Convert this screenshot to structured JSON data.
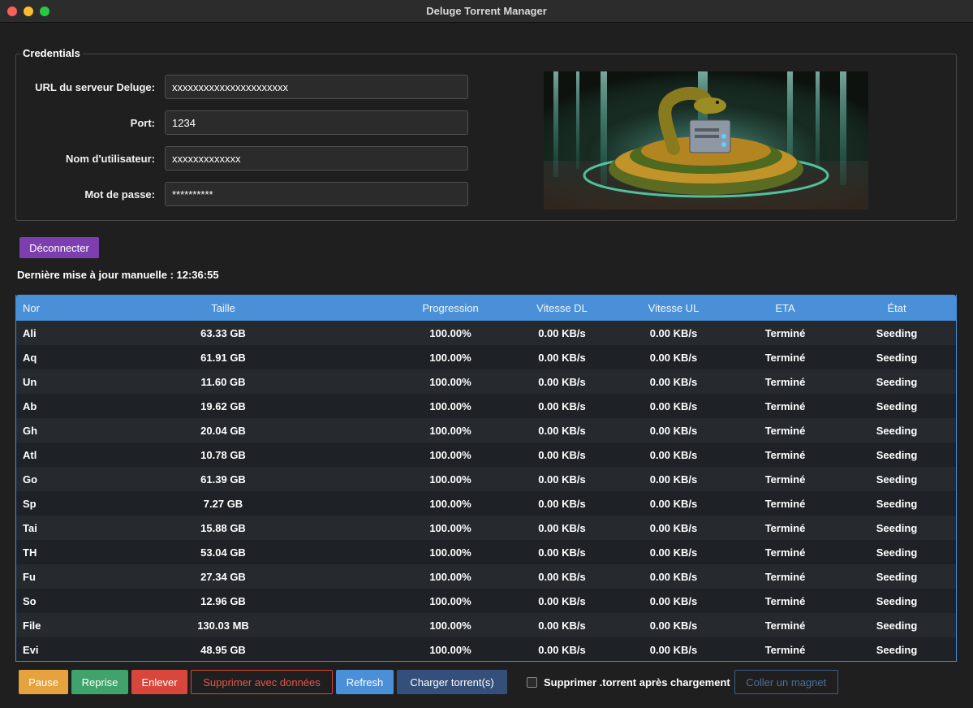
{
  "window": {
    "title": "Deluge Torrent Manager"
  },
  "credentials": {
    "legend": "Credentials",
    "url_label": "URL du serveur Deluge:",
    "url_value": "xxxxxxxxxxxxxxxxxxxxxx",
    "port_label": "Port:",
    "port_value": "1234",
    "user_label": "Nom d'utilisateur:",
    "user_value": "xxxxxxxxxxxxx",
    "password_label": "Mot de passe:",
    "password_value": "**********"
  },
  "actions": {
    "disconnect": "Déconnecter"
  },
  "status": {
    "last_update": "Dernière mise à jour manuelle : 12:36:55"
  },
  "table": {
    "columns": [
      "Nor",
      "Taille",
      "Progression",
      "Vitesse DL",
      "Vitesse UL",
      "ETA",
      "État"
    ],
    "rows": [
      [
        "Ali",
        "63.33 GB",
        "100.00%",
        "0.00 KB/s",
        "0.00 KB/s",
        "Terminé",
        "Seeding"
      ],
      [
        "Aq",
        "61.91 GB",
        "100.00%",
        "0.00 KB/s",
        "0.00 KB/s",
        "Terminé",
        "Seeding"
      ],
      [
        "Un",
        "11.60 GB",
        "100.00%",
        "0.00 KB/s",
        "0.00 KB/s",
        "Terminé",
        "Seeding"
      ],
      [
        "Ab",
        "19.62 GB",
        "100.00%",
        "0.00 KB/s",
        "0.00 KB/s",
        "Terminé",
        "Seeding"
      ],
      [
        "Gh",
        "20.04 GB",
        "100.00%",
        "0.00 KB/s",
        "0.00 KB/s",
        "Terminé",
        "Seeding"
      ],
      [
        "Atl",
        "10.78 GB",
        "100.00%",
        "0.00 KB/s",
        "0.00 KB/s",
        "Terminé",
        "Seeding"
      ],
      [
        "Go",
        "61.39 GB",
        "100.00%",
        "0.00 KB/s",
        "0.00 KB/s",
        "Terminé",
        "Seeding"
      ],
      [
        "Sp",
        "7.27 GB",
        "100.00%",
        "0.00 KB/s",
        "0.00 KB/s",
        "Terminé",
        "Seeding"
      ],
      [
        "Tai",
        "15.88 GB",
        "100.00%",
        "0.00 KB/s",
        "0.00 KB/s",
        "Terminé",
        "Seeding"
      ],
      [
        "TH",
        "53.04 GB",
        "100.00%",
        "0.00 KB/s",
        "0.00 KB/s",
        "Terminé",
        "Seeding"
      ],
      [
        "Fu",
        "27.34 GB",
        "100.00%",
        "0.00 KB/s",
        "0.00 KB/s",
        "Terminé",
        "Seeding"
      ],
      [
        "So",
        "12.96 GB",
        "100.00%",
        "0.00 KB/s",
        "0.00 KB/s",
        "Terminé",
        "Seeding"
      ],
      [
        "File",
        "130.03 MB",
        "100.00%",
        "0.00 KB/s",
        "0.00 KB/s",
        "Terminé",
        "Seeding"
      ],
      [
        "Evi",
        "48.95 GB",
        "100.00%",
        "0.00 KB/s",
        "0.00 KB/s",
        "Terminé",
        "Seeding"
      ]
    ]
  },
  "toolbar": {
    "pause": "Pause",
    "resume": "Reprise",
    "remove": "Enlever",
    "delete_with_data": "Supprimer avec données",
    "refresh": "Refresh",
    "load_torrents": "Charger torrent(s)",
    "delete_torrent_file_label": "Supprimer .torrent après chargement",
    "delete_torrent_file_checked": false,
    "paste_magnet": "Coller un magnet"
  },
  "colors": {
    "accent": "#4a90d9",
    "pause": "#e6a23c",
    "resume": "#3fa36b",
    "remove": "#d9463c",
    "disconnect": "#7d3fb0",
    "load": "#34507a"
  }
}
